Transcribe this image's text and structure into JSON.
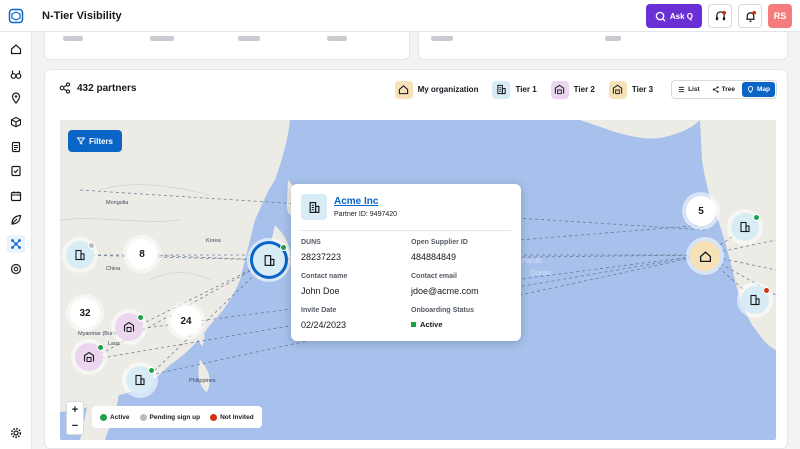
{
  "app": {
    "title": "N-Tier Visibility"
  },
  "header": {
    "ask_label": "Ask Q",
    "avatar_initials": "RS"
  },
  "panel": {
    "partners_count": "432 partners",
    "tiers": [
      {
        "label": "My organization",
        "color": "#f6e2b6"
      },
      {
        "label": "Tier 1",
        "color": "#d8ecf6"
      },
      {
        "label": "Tier 2",
        "color": "#ecd6ef"
      },
      {
        "label": "Tier 3",
        "color": "#f6e2b6"
      }
    ],
    "views": {
      "list": "List",
      "tree": "Tree",
      "map": "Map",
      "selected": "Map"
    }
  },
  "map": {
    "filters_label": "Filters",
    "labels": {
      "mongolia": "Mongolia",
      "china": "China",
      "korea": "Korea",
      "myanmar": "Myanmar (Burma)",
      "laos": "Laos",
      "philippines": "Philippines",
      "pacific": "Pacific",
      "ocean": "Ocean"
    },
    "clusters": [
      "8",
      "32",
      "24",
      "5"
    ],
    "legend": [
      {
        "label": "Active",
        "color": "#1fa14a"
      },
      {
        "label": "Pending sign up",
        "color": "#b8bcc1"
      },
      {
        "label": "Not Invited",
        "color": "#d13212"
      }
    ],
    "zoom_in": "+",
    "zoom_out": "−"
  },
  "popover": {
    "name": "Acme Inc",
    "partner_id": "Partner ID: 9497420",
    "duns_label": "DUNS",
    "duns": "28237223",
    "supplier_id_label": "Open Supplier ID",
    "supplier_id": "484884849",
    "contact_name_label": "Contact name",
    "contact_name": "John Doe",
    "contact_email_label": "Contact email",
    "contact_email": "jdoe@acme.com",
    "invite_date_label": "Invite Date",
    "invite_date": "02/24/2023",
    "onboarding_label": "Onboarding Status",
    "onboarding_status": "Active"
  }
}
